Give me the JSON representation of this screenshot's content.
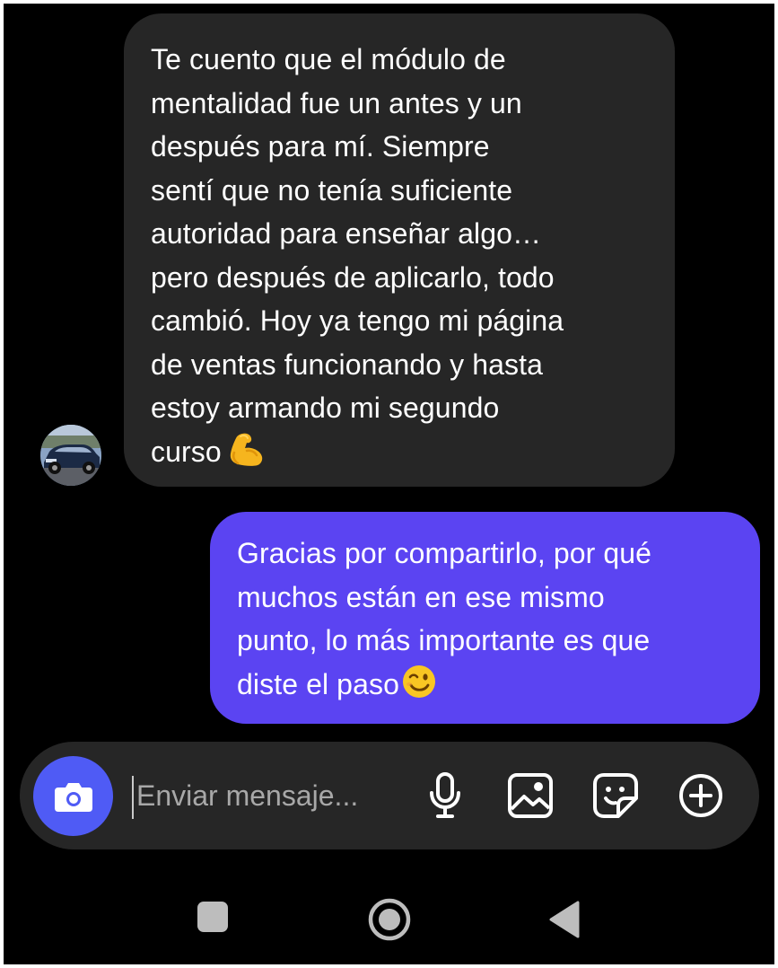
{
  "conversation": {
    "incoming": {
      "lines": [
        "Te cuento que el módulo de",
        "mentalidad fue un antes y un",
        "después para mí. Siempre",
        "sentí que no tenía suficiente",
        "autoridad para enseñar algo…",
        "pero después de aplicarlo, todo",
        "cambió. Hoy ya tengo mi página",
        "de ventas funcionando y hasta",
        "estoy armando mi segundo",
        "curso"
      ],
      "emoji": "flexed-biceps",
      "bubble_color": "#262626"
    },
    "outgoing": {
      "lines": [
        "Gracias por compartirlo, por qué",
        "muchos están en ese mismo",
        "punto, lo más importante es que",
        "diste el paso"
      ],
      "emoji": "winking-face",
      "bubble_color": "#5b44f2"
    }
  },
  "composer": {
    "placeholder": "Enviar mensaje...",
    "value": "",
    "camera_color": "#4f5bf5",
    "icons": [
      "camera-icon",
      "microphone-icon",
      "gallery-icon",
      "sticker-icon",
      "add-circle-icon"
    ]
  },
  "navbar": {
    "icons": [
      "recent-apps-icon",
      "home-icon",
      "back-icon"
    ]
  },
  "colors": {
    "background": "#000000",
    "text": "#ffffff",
    "placeholder": "#a8a8a8",
    "accent": "#5b44f2"
  }
}
